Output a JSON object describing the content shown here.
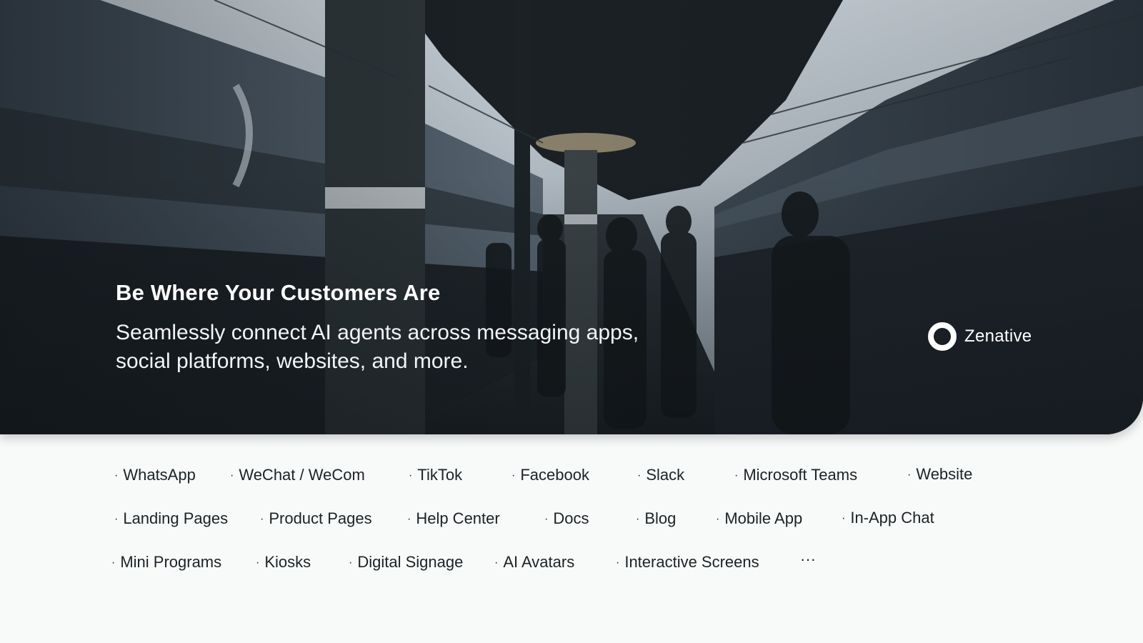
{
  "hero": {
    "title": "Be Where Your Customers Are",
    "subtitle": "Seamlessly connect AI agents across messaging apps, social platforms, websites, and more.",
    "photo": "train-station-platform"
  },
  "brand": {
    "name": "Zenative",
    "icon": "zenative-logo-icon"
  },
  "bullet": "·",
  "channels": {
    "row1": [
      "WhatsApp",
      "WeChat / WeCom",
      "TikTok",
      "Facebook",
      "Slack",
      "Microsoft Teams",
      "Website"
    ],
    "row2": [
      "Landing Pages",
      "Product Pages",
      "Help Center",
      "Docs",
      "Blog",
      "Mobile App",
      "In-App Chat"
    ],
    "row3": [
      "Mini Programs",
      "Kiosks",
      "Digital Signage",
      "AI Avatars",
      "Interactive Screens"
    ],
    "more": "···"
  },
  "colors": {
    "background": "#f8fafa",
    "text": "#1c2226",
    "hero_text": "#ffffff"
  }
}
